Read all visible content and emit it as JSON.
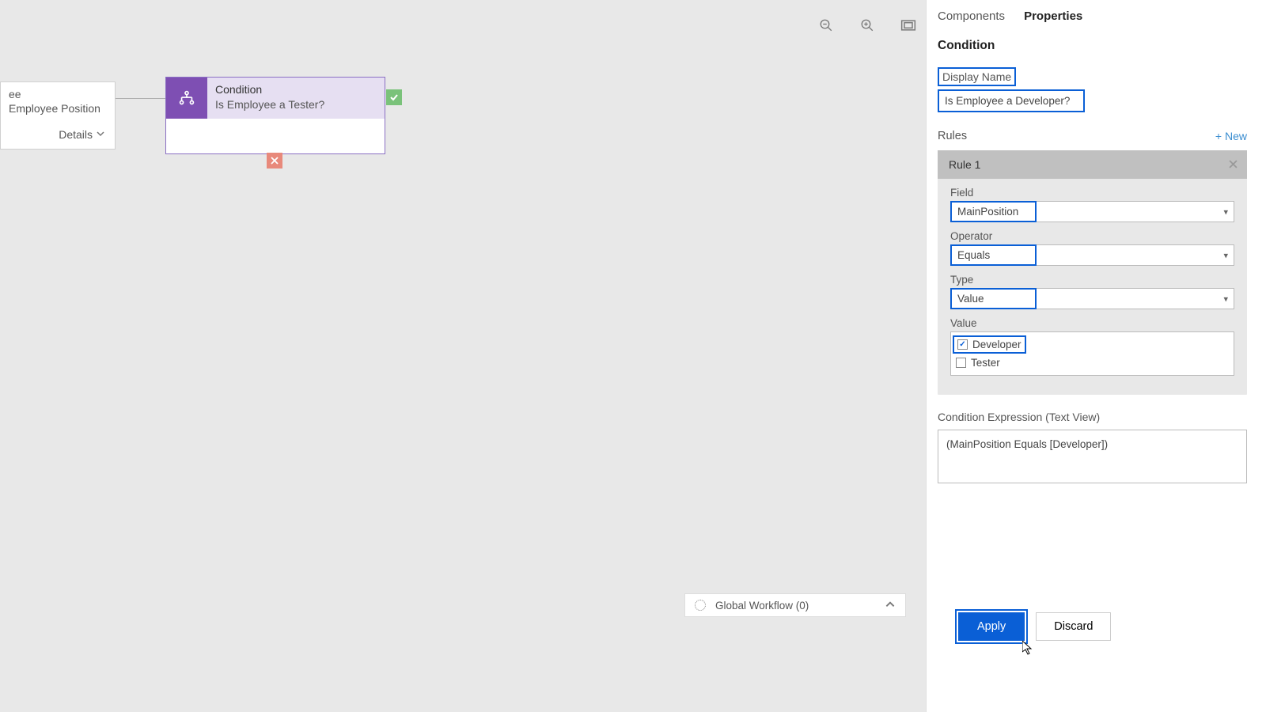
{
  "tabs": {
    "components": "Components",
    "properties": "Properties"
  },
  "section": {
    "condition": "Condition"
  },
  "form": {
    "display_name_label": "Display Name",
    "display_name_value": "Is Employee a Developer?",
    "rules_label": "Rules",
    "new_link": "+ New"
  },
  "rule": {
    "title": "Rule 1",
    "field_label": "Field",
    "field_value": "MainPosition",
    "operator_label": "Operator",
    "operator_value": "Equals",
    "type_label": "Type",
    "type_value": "Value",
    "value_label": "Value",
    "value_options": [
      {
        "label": "Developer",
        "checked": true,
        "highlight": true
      },
      {
        "label": "Tester",
        "checked": false,
        "highlight": false
      }
    ]
  },
  "expression": {
    "label": "Condition Expression (Text View)",
    "value": "(MainPosition Equals [Developer])"
  },
  "buttons": {
    "apply": "Apply",
    "discard": "Discard"
  },
  "canvas": {
    "entity_line1": "ee",
    "entity_line2": "Employee Position",
    "details": "Details",
    "condition_label": "Condition",
    "condition_name": "Is Employee a Tester?",
    "global_workflow": "Global Workflow (0)"
  }
}
